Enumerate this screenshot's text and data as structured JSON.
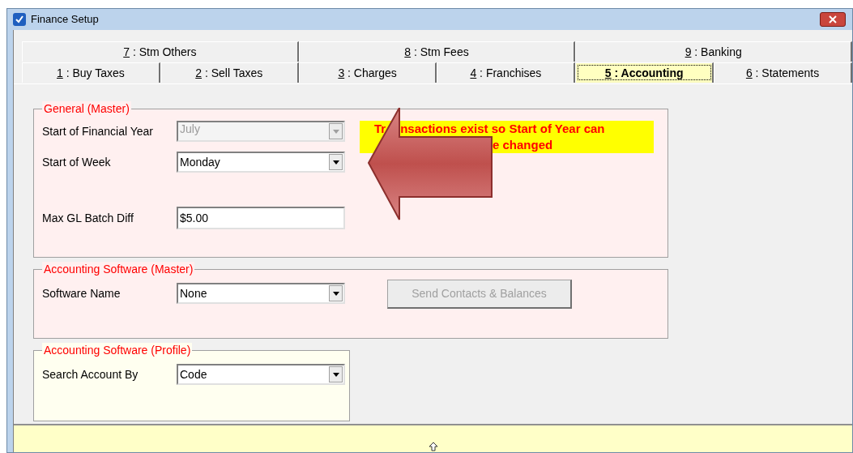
{
  "window": {
    "title": "Finance Setup"
  },
  "tab_rows": [
    [
      {
        "key": "7",
        "label": ": Stm Others",
        "selected": false
      },
      {
        "key": "8",
        "label": ": Stm Fees",
        "selected": false
      },
      {
        "key": "9",
        "label": ": Banking",
        "selected": false
      }
    ],
    [
      {
        "key": "1",
        "label": ": Buy Taxes",
        "selected": false
      },
      {
        "key": "2",
        "label": ": Sell Taxes",
        "selected": false
      },
      {
        "key": "3",
        "label": ": Charges",
        "selected": false
      },
      {
        "key": "4",
        "label": ": Franchises",
        "selected": false
      },
      {
        "key": "5",
        "label": ": Accounting",
        "selected": true
      },
      {
        "key": "6",
        "label": ": Statements",
        "selected": false
      }
    ]
  ],
  "general": {
    "title": "General (Master)",
    "fields": [
      {
        "label": "Start of Financial Year",
        "kind": "combo",
        "value": "July",
        "disabled": true
      },
      {
        "label": "Start of Week",
        "kind": "combo",
        "value": "Monday",
        "disabled": false
      },
      {
        "label": "Max GL Batch Diff",
        "kind": "text",
        "value": "$5.00",
        "disabled": false
      }
    ],
    "warning": {
      "line_1": [
        "Tr",
        "nsactions exist so Start of Year can"
      ],
      "line_2": [
        "e changed"
      ]
    }
  },
  "software_master": {
    "title": "Accounting Software (Master)",
    "fields": [
      {
        "label": "Software Name",
        "kind": "combo",
        "value": "None",
        "disabled": false
      }
    ],
    "button": {
      "label": "Send Contacts & Balances",
      "disabled": true
    }
  },
  "software_profile": {
    "title": "Accounting Software (Profile)",
    "fields": [
      {
        "label": "Search Account By",
        "kind": "combo",
        "value": "Code",
        "disabled": false
      }
    ]
  }
}
